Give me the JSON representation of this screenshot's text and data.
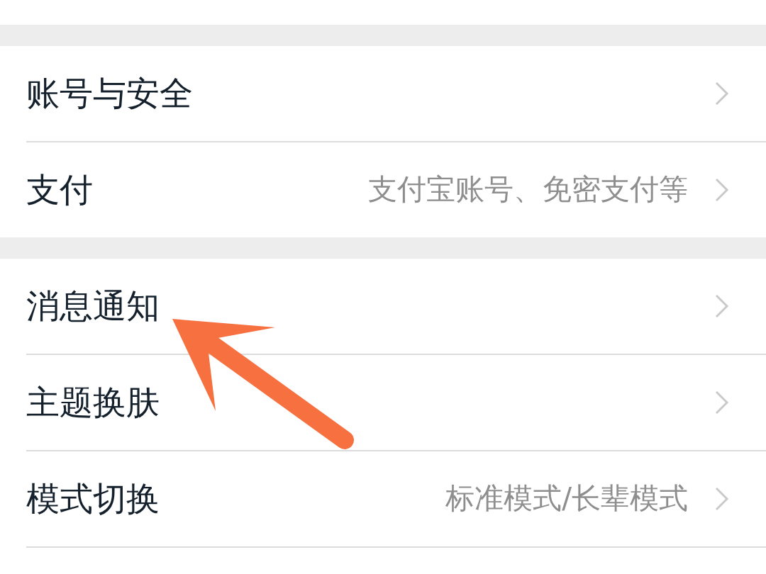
{
  "groups": [
    {
      "rows": [
        {
          "title": "账号与安全"
        },
        {
          "title": "支付",
          "value": "支付宝账号、免密支付等"
        }
      ]
    },
    {
      "rows": [
        {
          "title": "消息通知"
        },
        {
          "title": "主题换肤"
        },
        {
          "title": "模式切换",
          "value": "标准模式/长辈模式"
        }
      ]
    }
  ]
}
